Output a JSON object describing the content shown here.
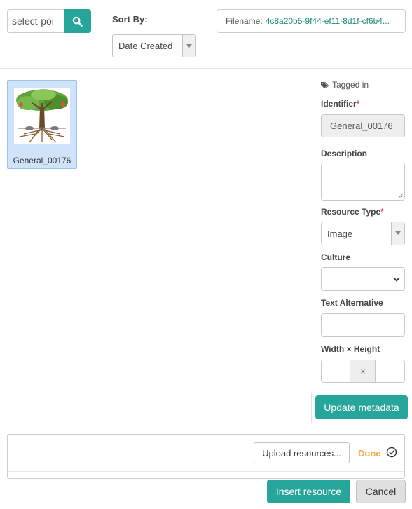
{
  "toolbar": {
    "search_value": "select-poi",
    "sort_label": "Sort By:",
    "sort_selected": "Date Created",
    "filename_label": "Filename:",
    "filename_value": "4c8a20b5-9f44-ef11-8d1f-cf6b4..."
  },
  "gallery": {
    "items": [
      {
        "label": "General_00176",
        "selected": true
      }
    ]
  },
  "metadata": {
    "tagged_in": "Tagged in",
    "identifier_label": "Identifier",
    "identifier_value": "General_00176",
    "description_label": "Description",
    "description_value": "",
    "resource_type_label": "Resource Type",
    "resource_type_value": "Image",
    "culture_label": "Culture",
    "culture_value": "",
    "text_alt_label": "Text Alternative",
    "text_alt_value": "",
    "wh_label": "Width × Height",
    "wh_separator": "×",
    "width_value": "",
    "height_value": "",
    "update_button": "Update metadata"
  },
  "upload": {
    "upload_button": "Upload resources...",
    "done_label": "Done"
  },
  "footer": {
    "insert_button": "Insert resource",
    "cancel_button": "Cancel"
  },
  "colors": {
    "accent": "#26a69a",
    "selection_bg": "#cfe3fa",
    "done": "#f0ad4e",
    "required": "#e03030"
  },
  "icons": [
    "search-icon",
    "tag-icon",
    "caret-down-icon",
    "chevron-down-icon",
    "check-circle-icon",
    "resize-grip-icon"
  ]
}
